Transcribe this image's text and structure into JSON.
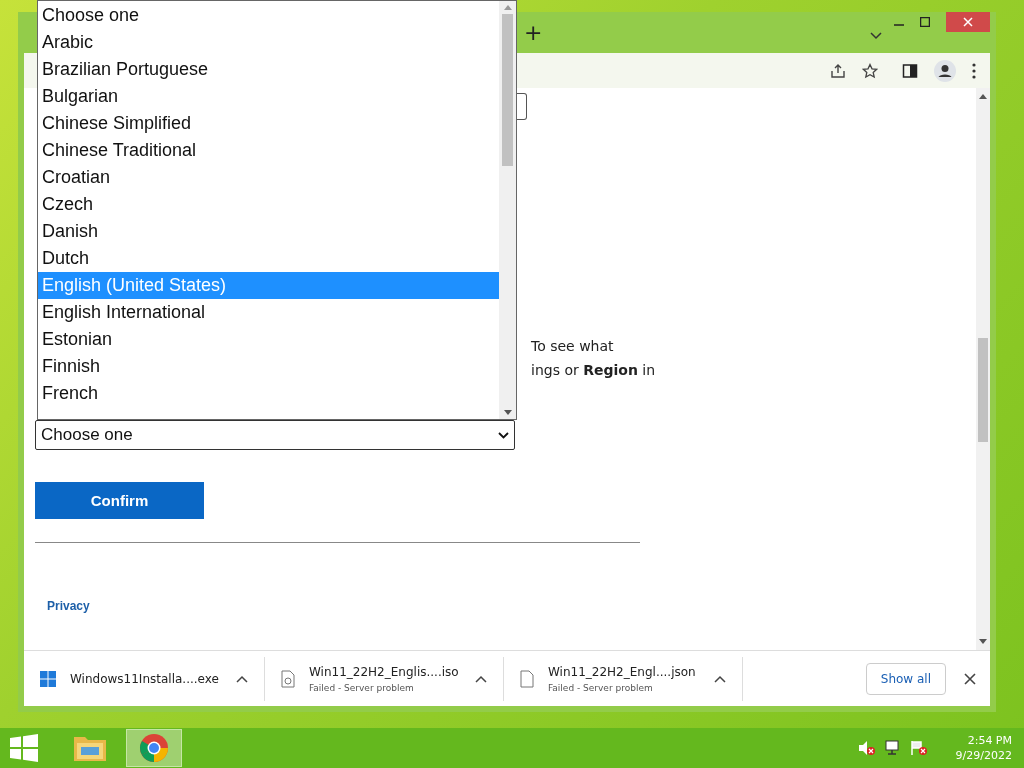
{
  "tab_strip": {
    "new_tab_label": "+"
  },
  "dropdown_list": {
    "options": [
      {
        "label": "Choose one",
        "selected": false
      },
      {
        "label": "Arabic",
        "selected": false
      },
      {
        "label": "Brazilian Portuguese",
        "selected": false
      },
      {
        "label": "Bulgarian",
        "selected": false
      },
      {
        "label": "Chinese Simplified",
        "selected": false
      },
      {
        "label": "Chinese Traditional",
        "selected": false
      },
      {
        "label": "Croatian",
        "selected": false
      },
      {
        "label": "Czech",
        "selected": false
      },
      {
        "label": "Danish",
        "selected": false
      },
      {
        "label": "Dutch",
        "selected": false
      },
      {
        "label": "English (United States)",
        "selected": true
      },
      {
        "label": "English International",
        "selected": false
      },
      {
        "label": "Estonian",
        "selected": false
      },
      {
        "label": "Finnish",
        "selected": false
      },
      {
        "label": "French",
        "selected": false
      }
    ]
  },
  "page": {
    "text_lines": [
      "To see what",
      "ings or **Region** in"
    ],
    "language_select": {
      "value": "Choose one"
    },
    "confirm_button": "Confirm",
    "footer_link": "Privacy"
  },
  "downloads": {
    "items": [
      {
        "kind": "windows",
        "name": "Windows11Installa....exe"
      },
      {
        "kind": "disc",
        "name": "Win11_22H2_Englis....iso",
        "status": "Failed - Server problem"
      },
      {
        "kind": "file",
        "name": "Win11_22H2_Engl....json",
        "status": "Failed - Server problem"
      }
    ],
    "show_all": "Show all"
  },
  "taskbar": {
    "apps": [
      {
        "kind": "folder",
        "selected": false
      },
      {
        "kind": "chrome",
        "selected": true
      }
    ],
    "time": "2:54 PM",
    "date": "9/29/2022"
  }
}
